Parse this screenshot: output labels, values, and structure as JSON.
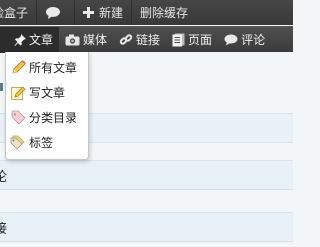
{
  "admin_bar": {
    "item1_label": "险盒子",
    "comments_icon": "speech-bubble-icon",
    "new_label": "新建",
    "new_icon": "plus-icon",
    "clear_cache_label": "删除缓存"
  },
  "nav": {
    "posts": {
      "label": "文章",
      "icon": "pin-icon"
    },
    "media": {
      "label": "媒体",
      "icon": "camera-icon"
    },
    "links": {
      "label": "链接",
      "icon": "chain-link-icon"
    },
    "pages": {
      "label": "页面",
      "icon": "page-icon"
    },
    "comments": {
      "label": "评论",
      "icon": "speech-bubble-icon"
    }
  },
  "dropdown": {
    "all_posts": {
      "label": "所有文章",
      "icon": "pencil-icon"
    },
    "write_post": {
      "label": "写文章",
      "icon": "pencil-note-icon"
    },
    "categories": {
      "label": "分类目录",
      "icon": "tag-icon"
    },
    "tags": {
      "label": "标签",
      "icon": "tags-icon"
    }
  },
  "rows": {
    "comments_row": "论",
    "links_row": "接"
  }
}
